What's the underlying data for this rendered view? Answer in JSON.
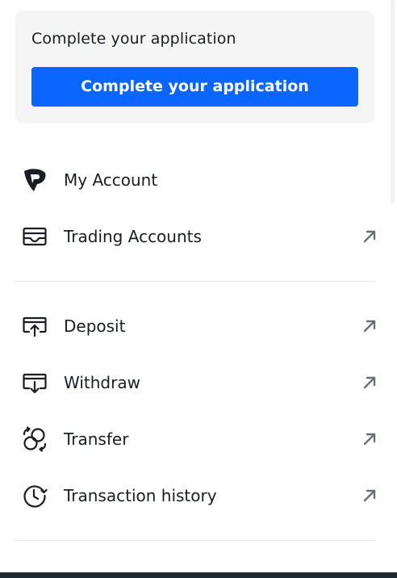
{
  "application_card": {
    "title": "Complete your application",
    "button_label": "Complete your application"
  },
  "menu": {
    "section1": [
      {
        "label": "My Account",
        "icon": "brand-logo-icon",
        "external": false
      },
      {
        "label": "Trading Accounts",
        "icon": "wallet-icon",
        "external": true
      }
    ],
    "section2": [
      {
        "label": "Deposit",
        "icon": "deposit-icon",
        "external": true
      },
      {
        "label": "Withdraw",
        "icon": "withdraw-icon",
        "external": true
      },
      {
        "label": "Transfer",
        "icon": "transfer-icon",
        "external": true
      },
      {
        "label": "Transaction history",
        "icon": "history-icon",
        "external": true
      }
    ]
  },
  "colors": {
    "primary_button": "#0a66ff",
    "card_background": "#f5f5f5",
    "text": "#1a1d24",
    "arrow": "#6b6f78",
    "bottom_bar": "#1e2a33"
  }
}
